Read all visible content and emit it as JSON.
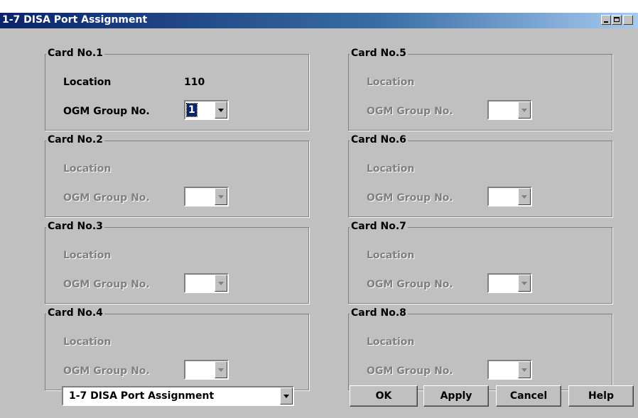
{
  "window": {
    "title": "1-7 DISA Port Assignment"
  },
  "cards": [
    {
      "label": "Card No.1",
      "location_label": "Location",
      "location_value": "110",
      "ogm_label": "OGM Group No.",
      "ogm_value": "1",
      "enabled": true
    },
    {
      "label": "Card No.2",
      "location_label": "Location",
      "location_value": "",
      "ogm_label": "OGM Group No.",
      "ogm_value": "",
      "enabled": false
    },
    {
      "label": "Card No.3",
      "location_label": "Location",
      "location_value": "",
      "ogm_label": "OGM Group No.",
      "ogm_value": "",
      "enabled": false
    },
    {
      "label": "Card No.4",
      "location_label": "Location",
      "location_value": "",
      "ogm_label": "OGM Group No.",
      "ogm_value": "",
      "enabled": false
    },
    {
      "label": "Card No.5",
      "location_label": "Location",
      "location_value": "",
      "ogm_label": "OGM Group No.",
      "ogm_value": "",
      "enabled": false
    },
    {
      "label": "Card No.6",
      "location_label": "Location",
      "location_value": "",
      "ogm_label": "OGM Group No.",
      "ogm_value": "",
      "enabled": false
    },
    {
      "label": "Card No.7",
      "location_label": "Location",
      "location_value": "",
      "ogm_label": "OGM Group No.",
      "ogm_value": "",
      "enabled": false
    },
    {
      "label": "Card No.8",
      "location_label": "Location",
      "location_value": "",
      "ogm_label": "OGM Group No.",
      "ogm_value": "",
      "enabled": false
    }
  ],
  "footer": {
    "screen_select_value": "1-7 DISA Port Assignment",
    "ok_label": "OK",
    "apply_label": "Apply",
    "cancel_label": "Cancel",
    "help_label": "Help"
  },
  "colors": {
    "title_bar": "#0a246a",
    "dialog_bg": "#c0c0c0",
    "disabled_text": "#808080"
  }
}
